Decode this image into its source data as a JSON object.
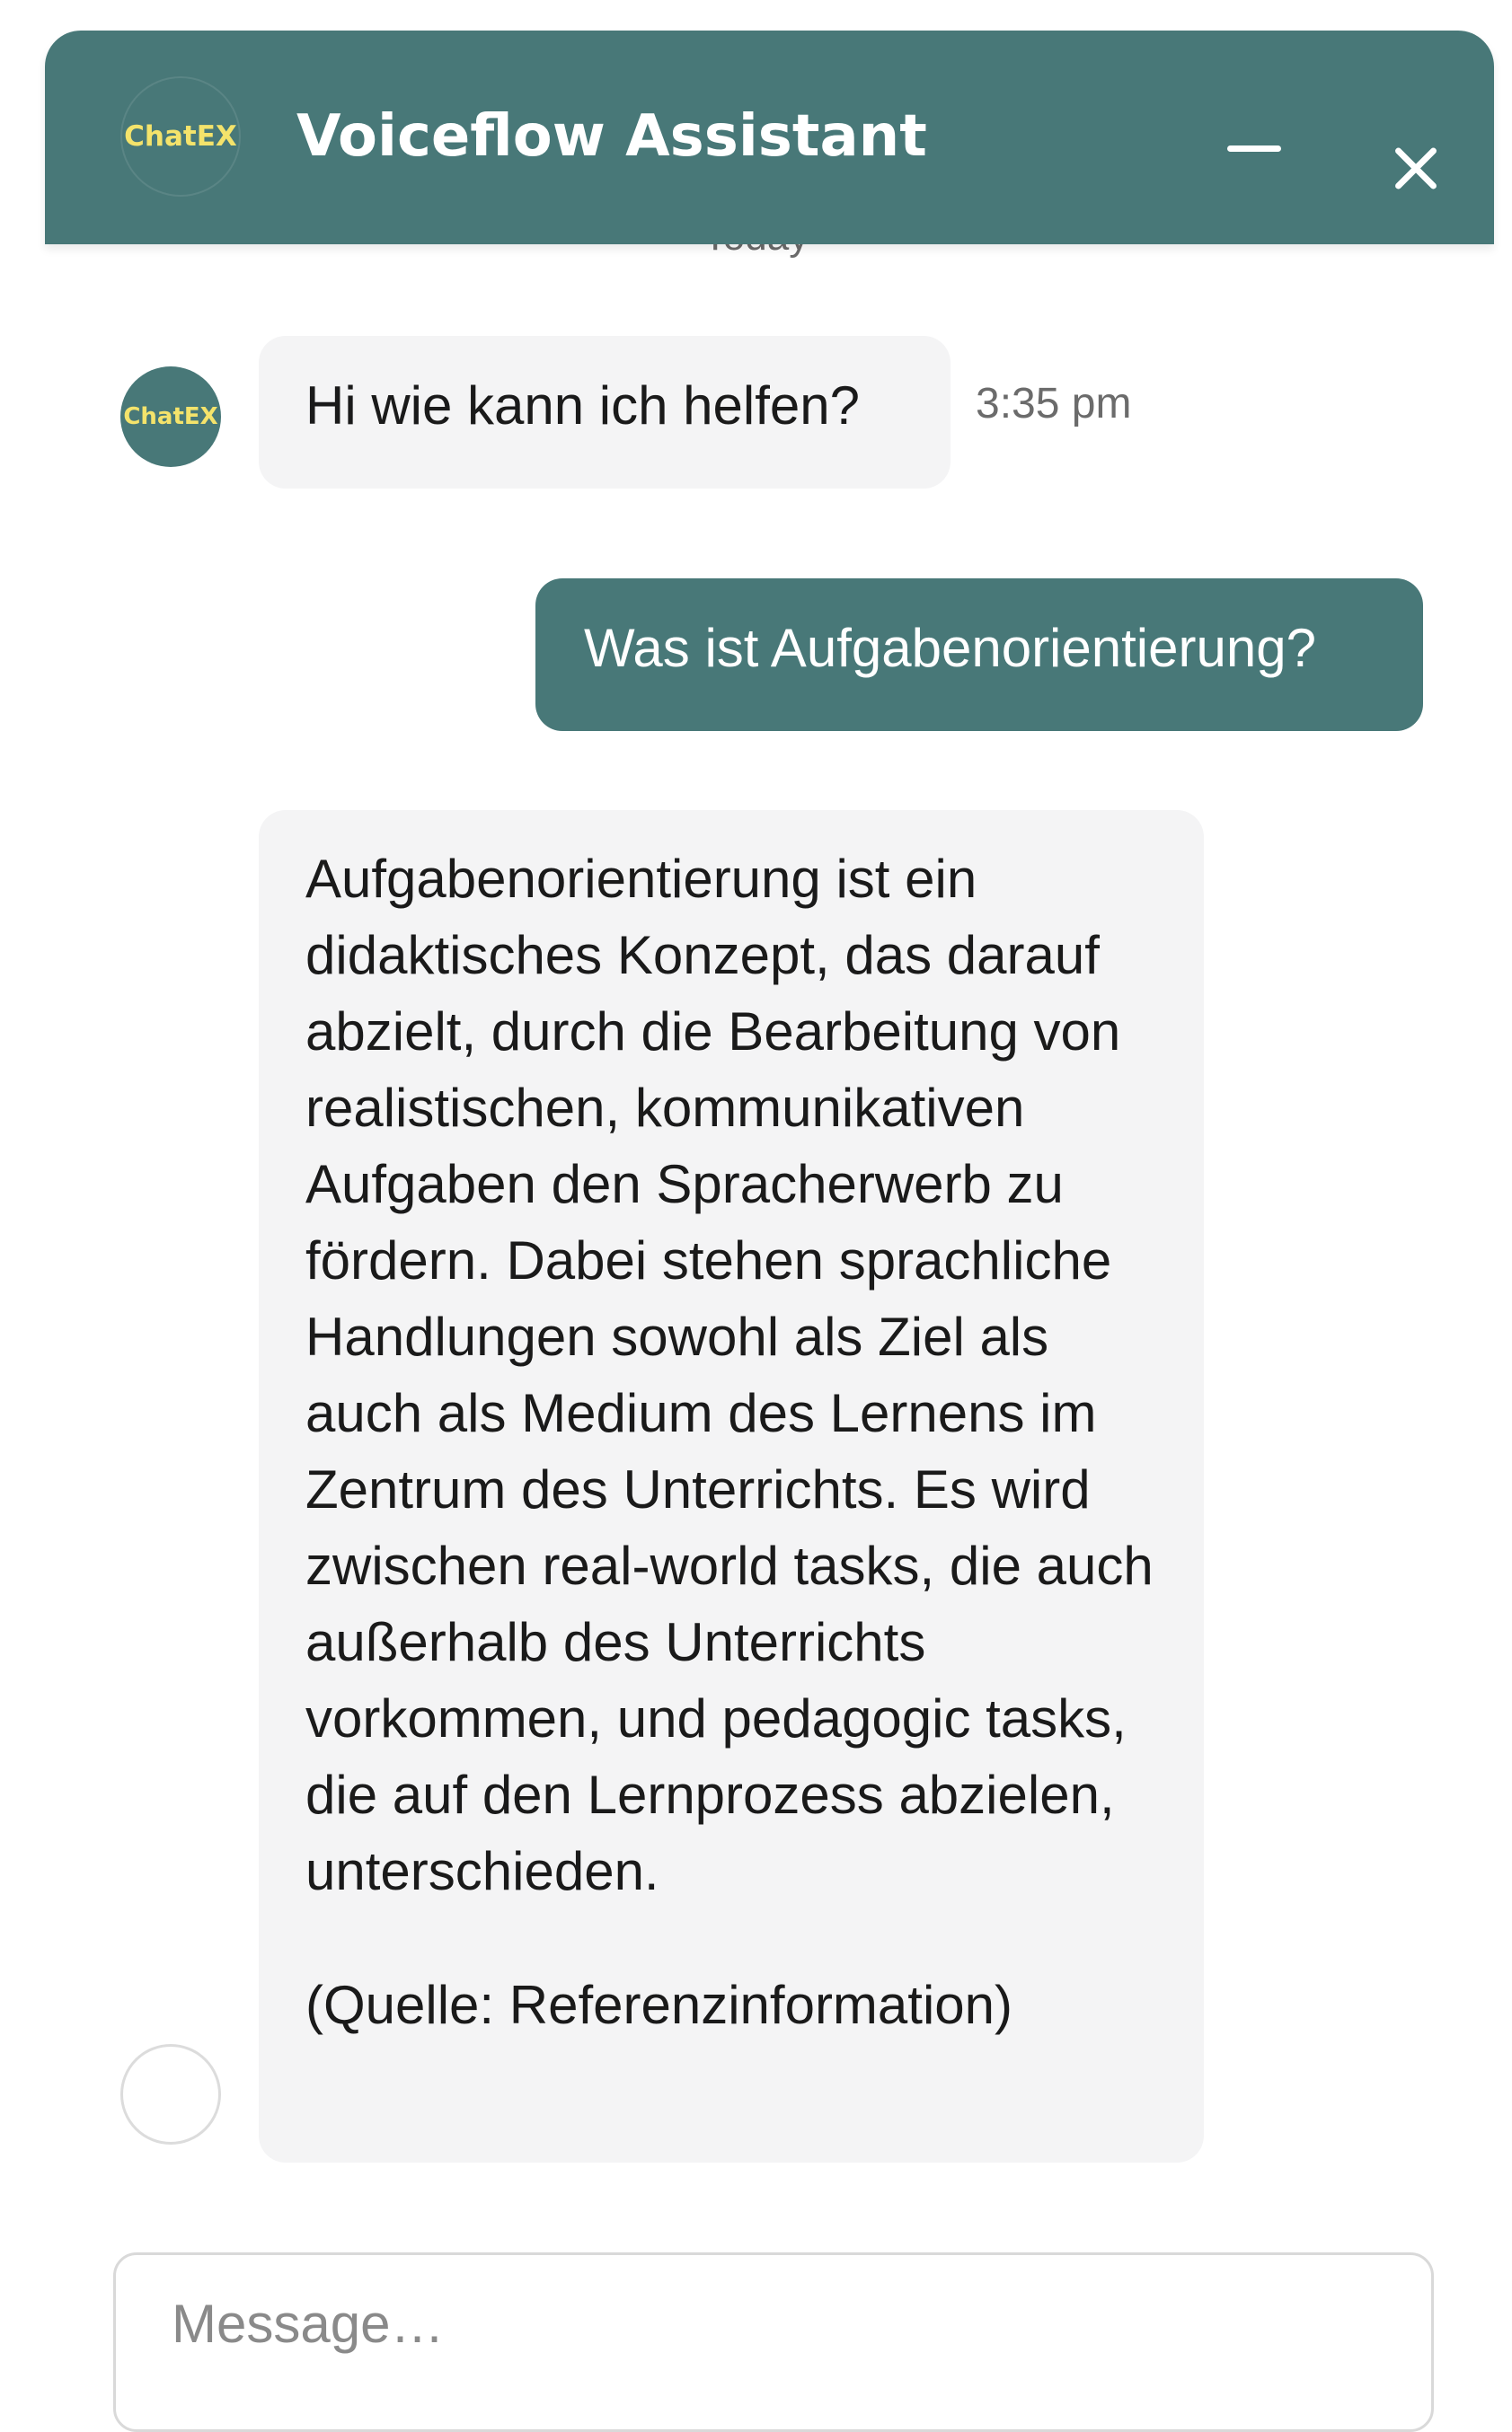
{
  "header": {
    "logo_text": "ChatEX",
    "title": "Voiceflow Assistant"
  },
  "conversation": {
    "day_separator": "Today",
    "messages": [
      {
        "sender": "bot",
        "text": "Hi wie kann ich helfen?",
        "time": "3:35 pm",
        "avatar_text": "ChatEX"
      },
      {
        "sender": "user",
        "text": "Was ist Aufgabenorientierung?"
      },
      {
        "sender": "bot",
        "text": "Aufgabenorientierung ist ein didaktisches Konzept, das darauf abzielt, durch die Bearbeitung von realistischen, kommunikativen Aufgaben den Spracherwerb zu fördern. Dabei stehen sprachliche Handlungen sowohl als Ziel als auch als Medium des Lernens im Zentrum des Unterrichts. Es wird zwischen real-world tasks, die auch außerhalb des Unterrichts vorkommen, und pedagogic tasks, die auf den Lernprozess abzielen, unterschieden.",
        "source": "(Quelle: Referenzinformation)"
      }
    ]
  },
  "composer": {
    "placeholder": "Message…",
    "value": ""
  },
  "colors": {
    "brand": "#487878",
    "logo_text": "#f4e36b",
    "bot_bubble": "#f4f4f5",
    "user_bubble_text": "#ffffff"
  },
  "icons": [
    "minimize-icon",
    "close-icon"
  ]
}
